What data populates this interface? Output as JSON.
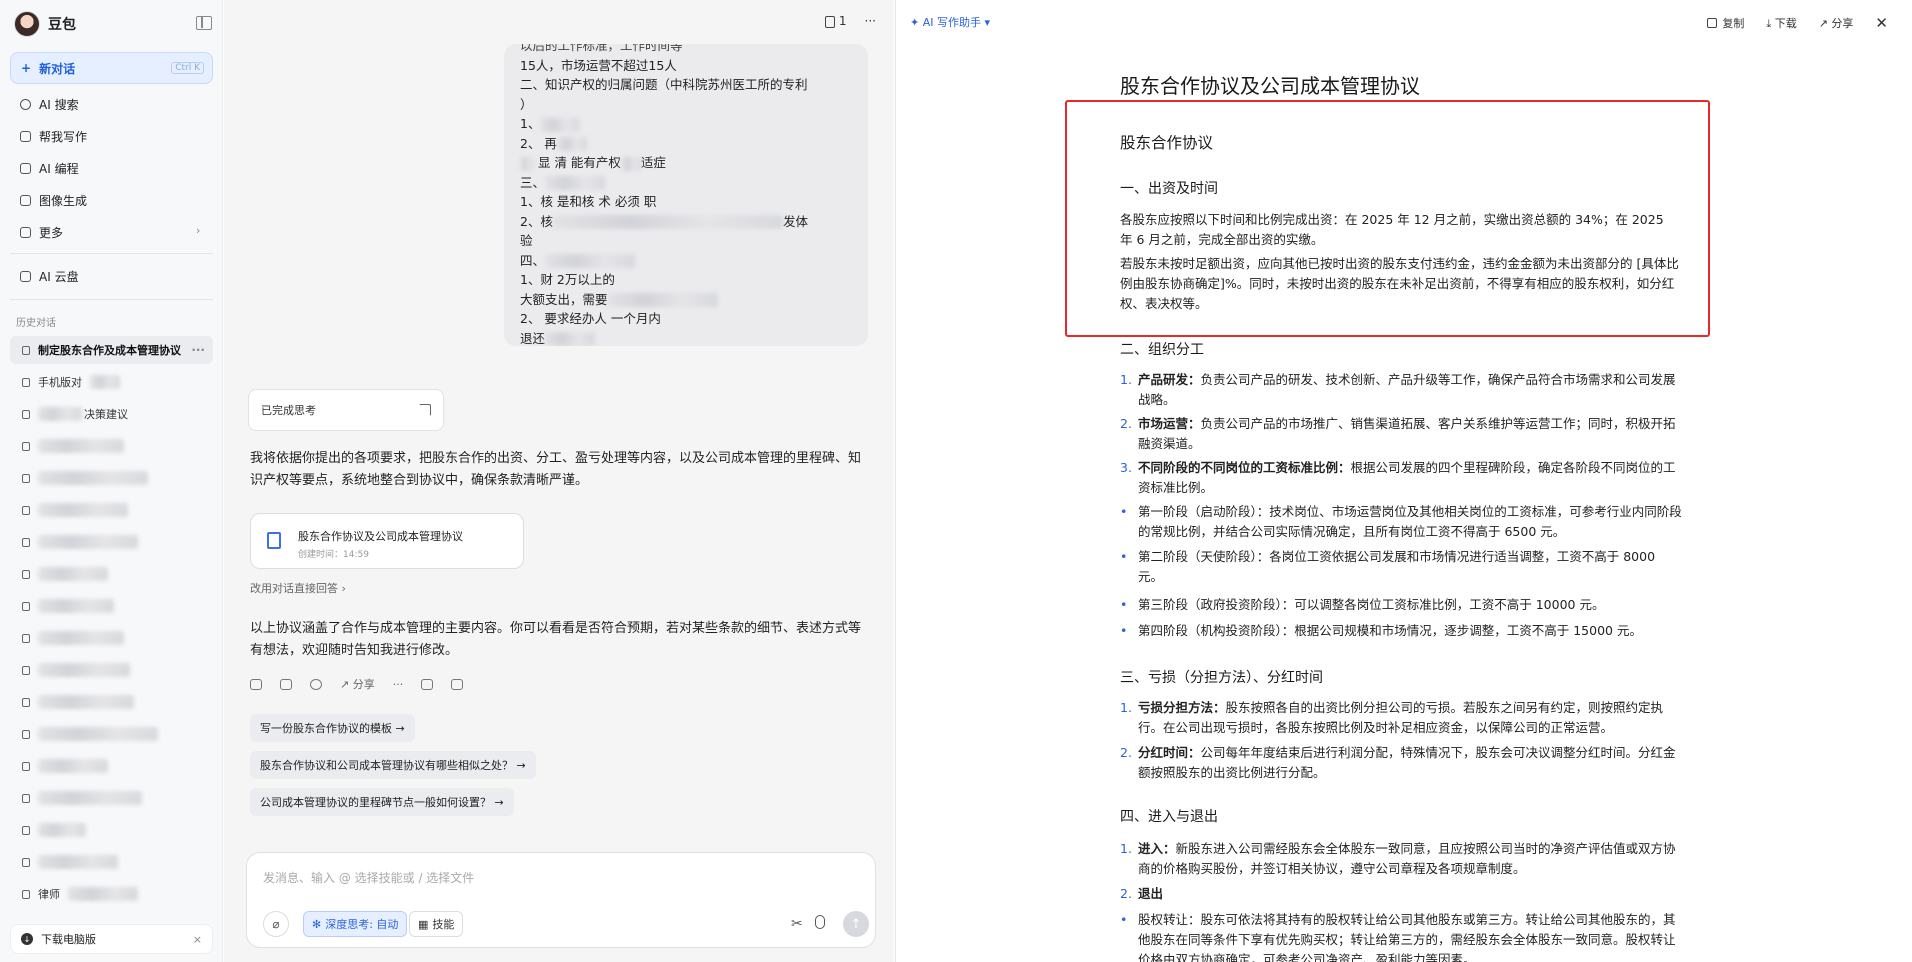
{
  "sidebar": {
    "brand": "豆包",
    "new_chat": "新对话",
    "new_chat_shortcut": "Ctrl K",
    "nav": [
      {
        "label": "AI 搜索",
        "icon": "search-icon"
      },
      {
        "label": "帮我写作",
        "icon": "pen-icon"
      },
      {
        "label": "AI 编程",
        "icon": "code-icon"
      },
      {
        "label": "图像生成",
        "icon": "image-icon"
      },
      {
        "label": "更多",
        "icon": "grid-icon"
      }
    ],
    "cloud": "AI 云盘",
    "history_label": "历史对话",
    "history_active": "制定股东合作及成本管理协议",
    "history_partial": [
      "手机版对",
      "   讨论文",
      "   决策建议",
      "   开博",
      "   入云",
      "",
      "",
      "",
      "",
      "",
      "",
      "   的",
      "   交易",
      "   条件",
      "   根",
      "   合",
      "   AI",
      "   生",
      "   备",
      "律师"
    ],
    "download": "下载电脑版"
  },
  "chat": {
    "doc_count": "1",
    "user_message_lines": [
      "以后的工作标准，工作时间等",
      "15人，市场运营不超过15人",
      "二、知识产权的归属问题（中科院苏州医工所的专利",
      "）",
      "1、",
      "2、     再",
      "    显    清       能有产权",
      "三、",
      "1、核      是和核     术     必须     职",
      "2、核",
      "验",
      "四、",
      "1、财                       2万以上的",
      "大额支出，需要",
      "2、                          要求经办人    一个月内",
      "退还"
    ],
    "thinking": "已完成思考",
    "reply_intro": "我将依据你提出的各项要求，把股东合作的出资、分工、盈亏处理等内容，以及公司成本管理的里程碑、知识产权等要点，系统地整合到协议中，确保条款清晰严谨。",
    "file_title": "股东合作协议及公司成本管理协议",
    "file_date": "创建时间：14:59",
    "direct_reply": "改用对话直接回答 ›",
    "reply_outro": "以上协议涵盖了合作与成本管理的主要内容。你可以看看是否符合预期，若对某些条款的细节、表述方式等有想法，欢迎随时告知我进行修改。",
    "share": "分享",
    "suggestions": [
      "写一份股东合作协议的模板 →",
      "股东合作协议和公司成本管理协议有哪些相似之处？ →",
      "公司成本管理协议的里程碑节点一般如何设置？ →"
    ],
    "input_placeholder": "发消息、输入 @ 选择技能或 / 选择文件",
    "deep_think": "深度思考: 自动",
    "skills": "技能"
  },
  "doc": {
    "helper": "AI 写作助手",
    "actions": [
      "复制",
      "下载",
      "分享"
    ],
    "title": "股东合作协议及公司成本管理协议",
    "sub_title": "股东合作协议",
    "s1": "一、出资及时间",
    "s1_p1": "各股东应按照以下时间和比例完成出资：在 2025 年 12 月之前，实缴出资总额的 34%；在 2025 年 6 月之前，完成全部出资的实缴。",
    "s1_p2": "若股东未按时足额出资，应向其他已按时出资的股东支付违约金，违约金金额为未出资部分的 [具体比例由股东协商确定]%。同时，未按时出资的股东在未补足出资前，不得享有相应的股东权利，如分红权、表决权等。",
    "s2": "二、组织分工",
    "s2_items": [
      {
        "num": "1.",
        "bold": "产品研发：",
        "text": "负责公司产品的研发、技术创新、产品升级等工作，确保产品符合市场需求和公司发展战略。"
      },
      {
        "num": "2.",
        "bold": "市场运营：",
        "text": "负责公司产品的市场推广、销售渠道拓展、客户关系维护等运营工作；同时，积极开拓融资渠道。"
      },
      {
        "num": "3.",
        "bold": "不同阶段的不同岗位的工资标准比例：",
        "text": "根据公司发展的四个里程碑阶段，确定各阶段不同岗位的工资标准比例。"
      }
    ],
    "s2_bullets": [
      "第一阶段（启动阶段）：技术岗位、市场运营岗位及其他相关岗位的工资标准，可参考行业内同阶段的常规比例，并结合公司实际情况确定，且所有岗位工资不得高于 6500 元。",
      "第二阶段（天使阶段）：各岗位工资依据公司发展和市场情况进行适当调整，工资不高于 8000 元。",
      "第三阶段（政府投资阶段）：可以调整各岗位工资标准比例，工资不高于 10000 元。",
      "第四阶段（机构投资阶段）：根据公司规模和市场情况，逐步调整，工资不高于 15000 元。"
    ],
    "s3": "三、亏损（分担方法）、分红时间",
    "s3_items": [
      {
        "num": "1.",
        "bold": "亏损分担方法：",
        "text": "股东按照各自的出资比例分担公司的亏损。若股东之间另有约定，则按照约定执行。在公司出现亏损时，各股东按照比例及时补足相应资金，以保障公司的正常运营。"
      },
      {
        "num": "2.",
        "bold": "分红时间：",
        "text": "公司每年年度结束后进行利润分配，特殊情况下，股东会可决议调整分红时间。分红金额按照股东的出资比例进行分配。"
      }
    ],
    "s4": "四、进入与退出",
    "s4_items": [
      {
        "num": "1.",
        "bold": "进入：",
        "text": "新股东进入公司需经股东会全体股东一致同意，且应按照公司当时的净资产评估值或双方协商的价格购买股份，并签订相关协议，遵守公司章程及各项规章制度。"
      },
      {
        "num": "2.",
        "bold": "退出",
        "text": ""
      }
    ],
    "s4_bullet": "股权转让：股东可依法将其持有的股权转让给公司其他股东或第三方。转让给公司其他股东的，其他股东在同等条件下享有优先购买权；转让给第三方的，需经股东会全体股东一致同意。股权转让价格由双方协商确定，可参考公司净资产、盈利能力等因素。"
  },
  "colors": {
    "accent": "#2a62e0",
    "highlight_box": "#e8282b"
  }
}
